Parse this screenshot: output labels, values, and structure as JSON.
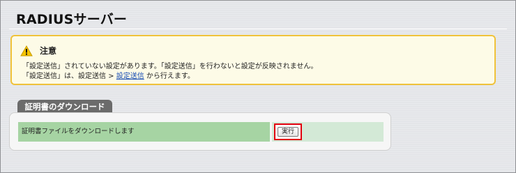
{
  "page": {
    "title": "RADIUSサーバー"
  },
  "notice": {
    "title": "注意",
    "line1": "「設定送信」されていない設定があります。「設定送信」を行わないと設定が反映されません。",
    "line2_prefix": "「設定送信」は、設定送信 > ",
    "line2_link": "設定送信",
    "line2_suffix": " から行えます。",
    "icon": "warning-icon",
    "border_color": "#f0c23a",
    "bg_color": "#fdfbe7"
  },
  "section": {
    "tab_label": "証明書のダウンロード",
    "row_label": "証明書ファイルをダウンロードします",
    "button_label": "実行",
    "row_label_color": "#a6d4a3",
    "row_action_color": "#d3e9d6",
    "highlight_color": "#e2000f"
  }
}
